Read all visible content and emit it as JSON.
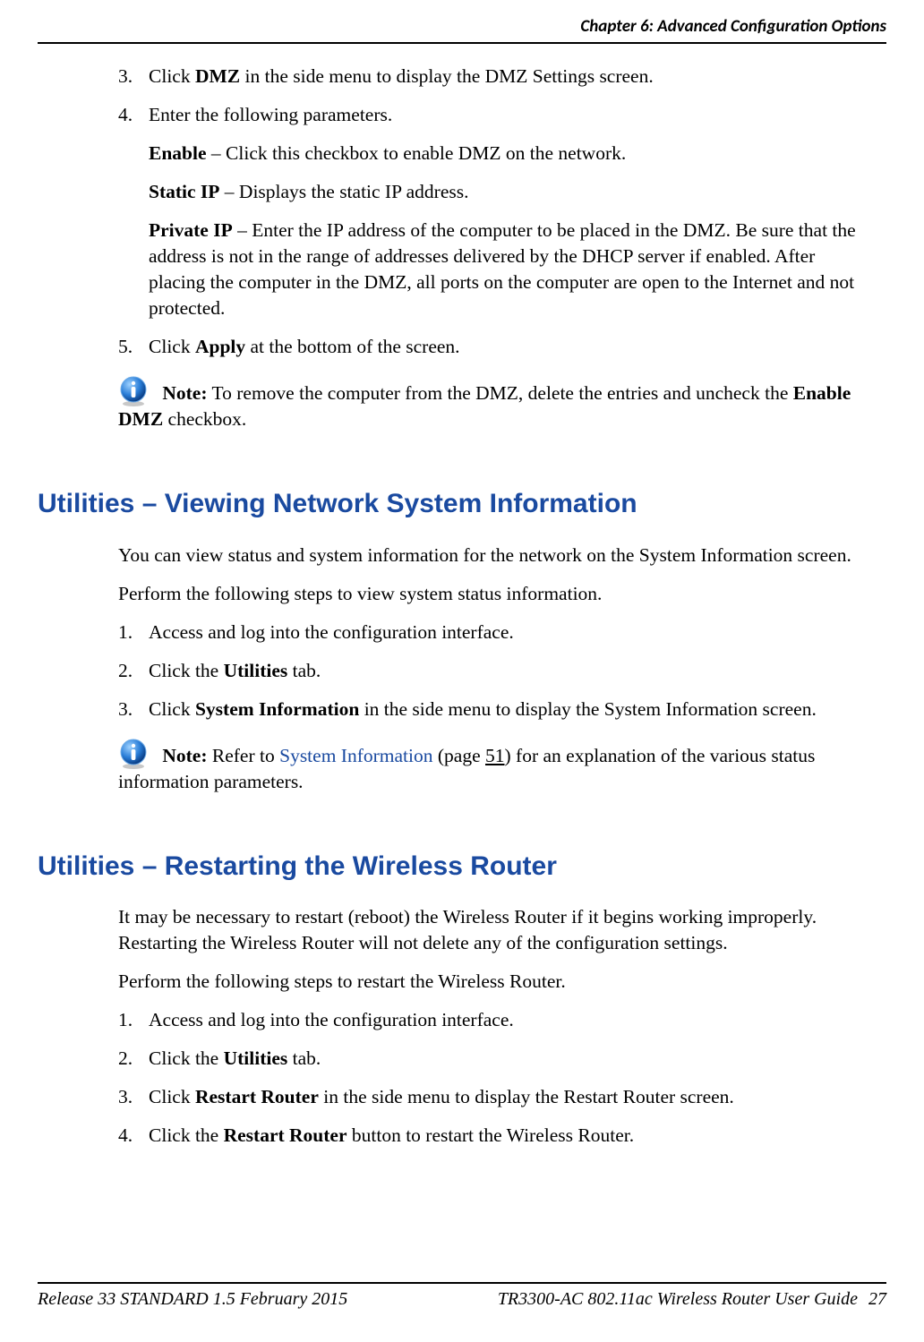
{
  "header": {
    "chapter": "Chapter 6: Advanced Configuration Options"
  },
  "section1": {
    "steps": {
      "s3": {
        "num": "3.",
        "pre": "Click ",
        "bold": "DMZ",
        "post": " in the side menu to display the DMZ Settings screen."
      },
      "s4": {
        "num": "4.",
        "intro": "Enter the following parameters.",
        "p1": {
          "label": "Enable",
          "text": " – Click this checkbox to enable DMZ on the network."
        },
        "p2": {
          "label": "Static IP",
          "text": " – Displays the static IP address."
        },
        "p3": {
          "label": "Private IP",
          "text": " – Enter the IP address of the computer to be placed in the DMZ. Be sure that the address is not in the range of addresses delivered by the DHCP server if enabled. After placing the computer in the DMZ, all ports on the computer are open to the Internet and not protected."
        }
      },
      "s5": {
        "num": "5.",
        "pre": "Click ",
        "bold": "Apply",
        "post": " at the bottom of the screen."
      }
    },
    "note": {
      "label": "Note:",
      "pre": "  To remove the computer from the DMZ, delete the entries and uncheck the ",
      "bold1": "Enable DMZ",
      "post": " checkbox."
    }
  },
  "section2": {
    "heading": "Utilities – Viewing Network System Information",
    "para1": "You can view status and system information for the network on the System Information screen.",
    "para2": "Perform the following steps to view system status information.",
    "steps": {
      "s1": {
        "num": "1.",
        "text": "Access and log into the configuration interface."
      },
      "s2": {
        "num": "2.",
        "pre": "Click the ",
        "bold": "Utilities",
        "post": " tab."
      },
      "s3": {
        "num": "3.",
        "pre": "Click ",
        "bold": "System Information",
        "post": " in the side menu to display the System Information screen."
      }
    },
    "note": {
      "label": "Note:",
      "pre": "  Refer to ",
      "link": "System Information",
      "mid": " (page ",
      "pagelink": "51",
      "post": ") for an explanation of the various status information parameters."
    }
  },
  "section3": {
    "heading": "Utilities – Restarting the Wireless Router",
    "para1": "It may be necessary to restart (reboot) the Wireless Router if it begins working improperly. Restarting the Wireless Router will not delete any of the configuration settings.",
    "para2": "Perform the following steps to restart the Wireless Router.",
    "steps": {
      "s1": {
        "num": "1.",
        "text": "Access and log into the configuration interface."
      },
      "s2": {
        "num": "2.",
        "pre": "Click the ",
        "bold": "Utilities",
        "post": " tab."
      },
      "s3": {
        "num": "3.",
        "pre": "Click ",
        "bold": "Restart Router",
        "post": " in the side menu to display the Restart Router screen."
      },
      "s4": {
        "num": "4.",
        "pre": "Click the ",
        "bold": "Restart Router",
        "post": " button to restart the Wireless Router."
      }
    }
  },
  "footer": {
    "left": "Release 33 STANDARD 1.5    February 2015",
    "right_title": "TR3300-AC 802.11ac Wireless Router User Guide",
    "page": "27"
  }
}
